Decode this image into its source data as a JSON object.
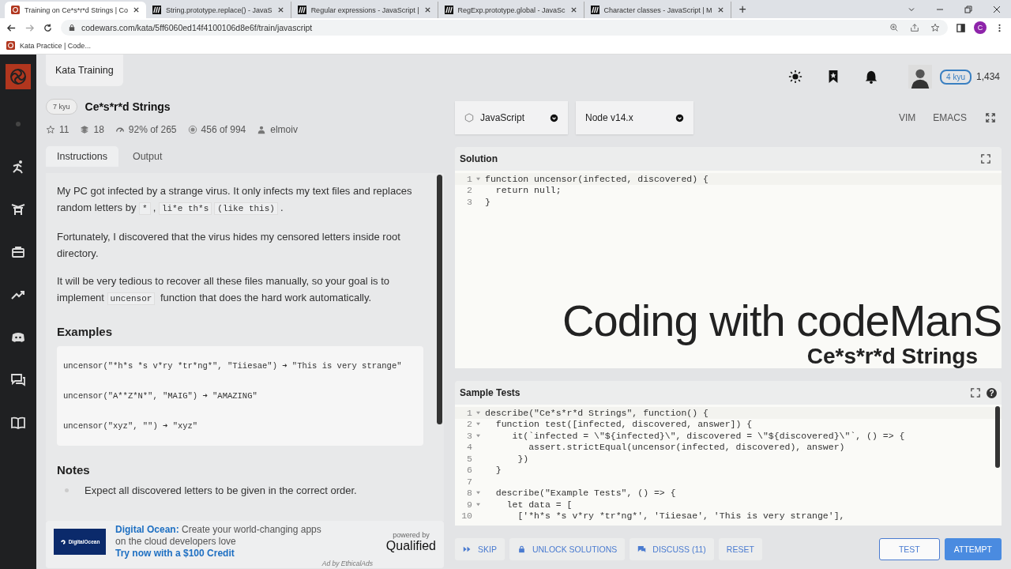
{
  "browser": {
    "tabs": [
      {
        "title": "Training on Ce*s*r*d Strings | Co",
        "selected": true,
        "kind": "codewars"
      },
      {
        "title": "String.prototype.replace() - JavaS",
        "selected": false,
        "kind": "mdn"
      },
      {
        "title": "Regular expressions - JavaScript |",
        "selected": false,
        "kind": "mdn"
      },
      {
        "title": "RegExp.prototype.global - JavaSc",
        "selected": false,
        "kind": "mdn"
      },
      {
        "title": "Character classes - JavaScript | M",
        "selected": false,
        "kind": "mdn"
      }
    ],
    "new_tab": "+",
    "url": "codewars.com/kata/5ff6060ed14f4100106d8e6f/train/javascript",
    "profile_initial": "C",
    "bookmarks": [
      "Kata Practice | Code..."
    ]
  },
  "header": {
    "section": "Kata Training",
    "rank": "4 kyu",
    "honor": "1,434"
  },
  "kata": {
    "rank": "7 kyu",
    "title": "Ce*s*r*d Strings",
    "stats": [
      {
        "kind": "stars",
        "text": "11"
      },
      {
        "kind": "collections",
        "text": "18"
      },
      {
        "kind": "satisfaction",
        "text": "92% of 265"
      },
      {
        "kind": "completed",
        "text": "456 of 994"
      },
      {
        "kind": "author",
        "text": "elmoiv"
      }
    ]
  },
  "tabs": [
    {
      "label": "Instructions",
      "selected": true
    },
    {
      "label": "Output",
      "selected": false
    }
  ],
  "instructions": {
    "paragraphs": [
      [
        {
          "kind": "text",
          "text": "My PC got infected by a strange virus. It only infects my text files and replaces random letters by "
        },
        {
          "kind": "code",
          "text": "*"
        },
        {
          "kind": "text",
          "text": ", "
        },
        {
          "kind": "code",
          "text": "li*e th*s"
        },
        {
          "kind": "code",
          "text": "(like this)"
        },
        {
          "kind": "text",
          "text": "."
        }
      ],
      [
        {
          "kind": "text",
          "text": "Fortunately, I discovered that the virus hides my censored letters inside root directory."
        }
      ],
      [
        {
          "kind": "text",
          "text": "It will be very tedious to recover all these files manually, so your goal is to implement "
        },
        {
          "kind": "code",
          "text": "uncensor"
        },
        {
          "kind": "text",
          "text": " function that does the hard work automatically."
        }
      ]
    ],
    "examples_heading": "Examples",
    "examples": [
      "uncensor(\"*h*s *s v*ry *tr*ng*\", \"Tiiesae\") ➜ \"This is very strange\"",
      "uncensor(\"A**Z*N*\", \"MAIG\") ➜ \"AMAZING\"",
      "uncensor(\"xyz\", \"\") ➜ \"xyz\""
    ],
    "notes_heading": "Notes",
    "notes": [
      "Expect all discovered letters to be given in the correct order."
    ]
  },
  "ad": {
    "logo": "DigitalOcean",
    "sponsor": "Digital Ocean:",
    "text": "Create your world-changing apps on the cloud developers love",
    "link": "Try now with a $100 Credit",
    "powered_by": "powered by",
    "brand": "Qualified",
    "attribution": "Ad by EthicalAds"
  },
  "editor_bar": {
    "language": "JavaScript",
    "version": "Node v14.x",
    "modes": [
      "VIM",
      "EMACS"
    ]
  },
  "solution": {
    "title": "Solution",
    "lines": [
      {
        "n": "1",
        "fold": true,
        "code": "function uncensor(infected, discovered) {"
      },
      {
        "n": "2",
        "fold": false,
        "code": "  return null;"
      },
      {
        "n": "3",
        "fold": false,
        "code": "}"
      }
    ]
  },
  "video_overlay": {
    "title": "Coding with codeManS",
    "subtitle": "Ce*s*r*d Strings"
  },
  "sample_tests": {
    "title": "Sample Tests",
    "help": "?",
    "lines": [
      {
        "n": "1",
        "fold": true,
        "code": "describe(\"Ce*s*r*d Strings\", function() {"
      },
      {
        "n": "2",
        "fold": true,
        "code": "  function test([infected, discovered, answer]) {"
      },
      {
        "n": "3",
        "fold": true,
        "code": "     it(`infected = \\\"${infected}\\\", discovered = \\\"${discovered}\\\"`, () => {"
      },
      {
        "n": "4",
        "fold": false,
        "code": "        assert.strictEqual(uncensor(infected, discovered), answer)"
      },
      {
        "n": "5",
        "fold": false,
        "code": "      })"
      },
      {
        "n": "6",
        "fold": false,
        "code": "  }"
      },
      {
        "n": "7",
        "fold": false
      },
      {
        "n": "8",
        "fold": true,
        "code": "  describe(\"Example Tests\", () => {"
      },
      {
        "n": "9",
        "fold": true,
        "code": "    let data = ["
      },
      {
        "n": "10",
        "fold": false,
        "code": "      ['*h*s *s v*ry *tr*ng*', 'Tiiesae', 'This is very strange'],"
      }
    ]
  },
  "actions": [
    {
      "kind": "skip",
      "label": "SKIP"
    },
    {
      "kind": "unlock",
      "label": "UNLOCK SOLUTIONS"
    },
    {
      "kind": "discuss",
      "label": "DISCUSS (11)"
    },
    {
      "kind": "plain",
      "label": "RESET"
    },
    {
      "kind": "outline",
      "label": "TEST"
    },
    {
      "kind": "primary",
      "label": "ATTEMPT"
    }
  ]
}
